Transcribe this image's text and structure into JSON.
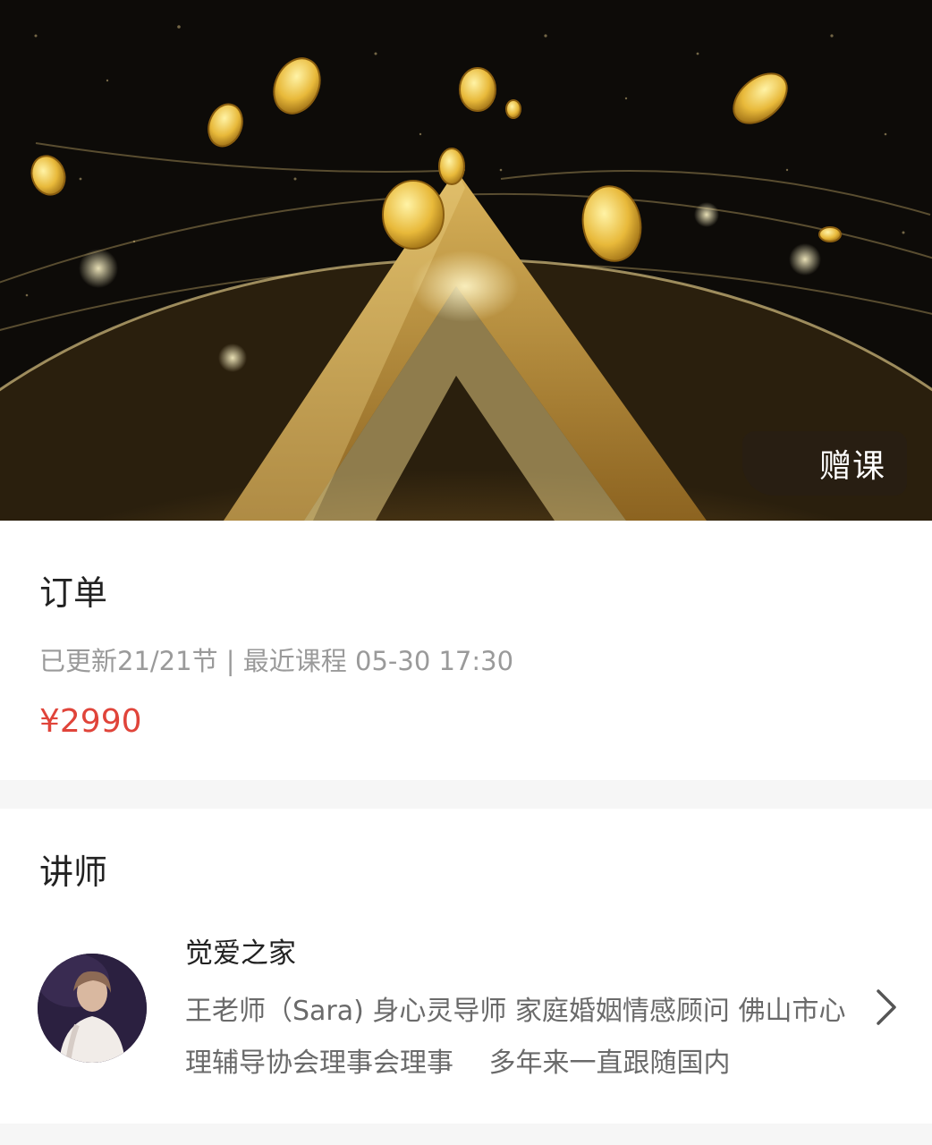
{
  "hero": {
    "badge_label": "赠课"
  },
  "order": {
    "title": "订单",
    "meta": "已更新21/21节 | 最近课程 05-30 17:30",
    "price": "¥2990"
  },
  "lecturer": {
    "section_title": "讲师",
    "name": "觉爱之家",
    "description": "王老师（Sara) 身心灵导师 家庭婚姻情感顾问 佛山市心理辅导协会理事会理事　 多年来一直跟随国内"
  },
  "colors": {
    "price": "#e0443a",
    "meta_text": "#9a9a9a",
    "badge_bg": "rgba(40,30,20,0.82)",
    "gold": "#e8b93a"
  },
  "icons": {
    "chevron": "chevron-right-icon"
  }
}
